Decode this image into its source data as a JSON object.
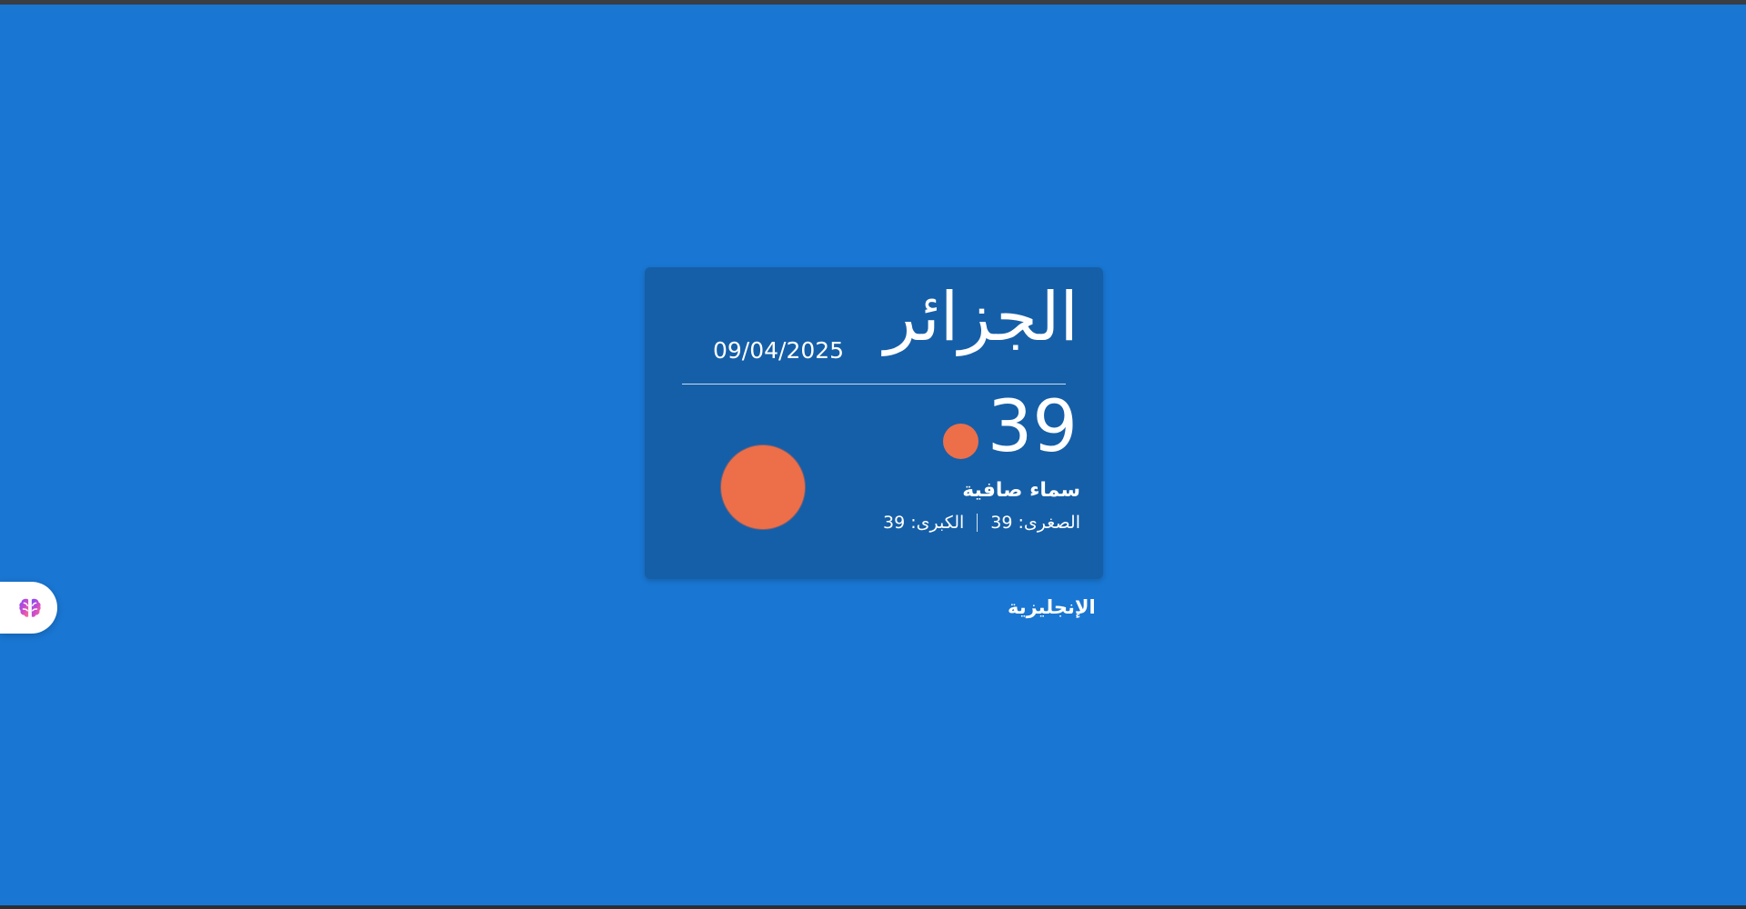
{
  "weather_card": {
    "city": "الجزائر",
    "date": "09/04/2025",
    "temperature": "39",
    "condition": "سماء صافية",
    "min_label": "الصغرى: 39",
    "max_label": "الكبرى: 39",
    "icon": "sun-icon",
    "accent_color": "#ec6f4a"
  },
  "language_link": {
    "label": "الإنجليزية"
  },
  "assistant_widget": {
    "icon": "brain-icon"
  },
  "colors": {
    "background": "#1976d2",
    "card_background": "#155fa8",
    "text": "#ffffff"
  }
}
